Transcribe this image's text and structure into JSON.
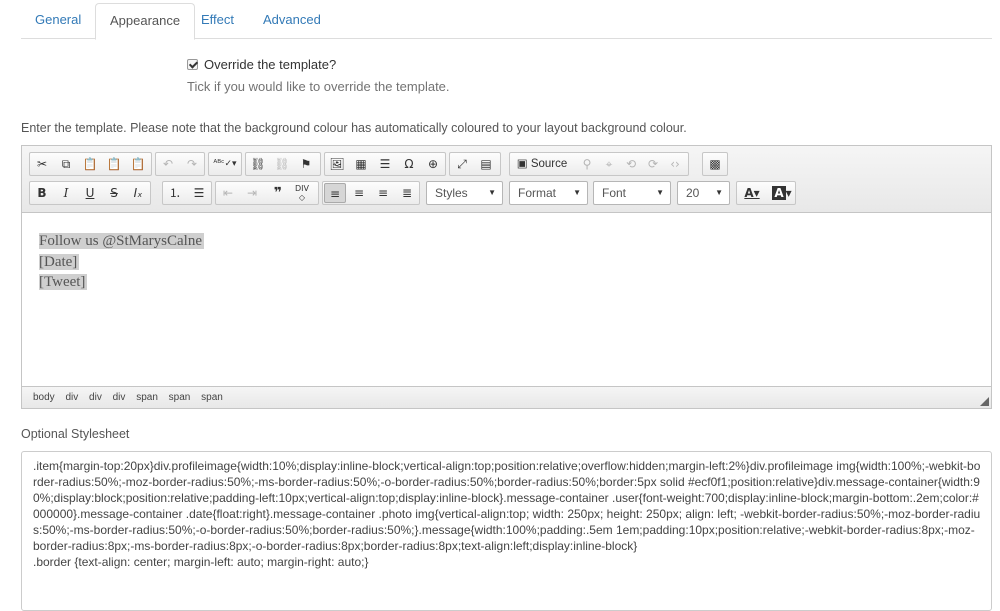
{
  "tabs": [
    {
      "label": "General",
      "active": false
    },
    {
      "label": "Appearance",
      "active": true
    },
    {
      "label": "Effect",
      "active": false
    },
    {
      "label": "Advanced",
      "active": false
    }
  ],
  "override": {
    "label": "Override the template?",
    "checked": true,
    "help": "Tick if you would like to override the template."
  },
  "intro": "Enter the template. Please note that the background colour has automatically coloured to your layout background colour.",
  "editor": {
    "source_label": "Source",
    "styles": "Styles",
    "format": "Format",
    "font": "Font",
    "size": "20",
    "content_lines": [
      "Follow us @StMarysCalne",
      "[Date]",
      "[Tweet]"
    ],
    "path": [
      "body",
      "div",
      "div",
      "div",
      "span",
      "span",
      "span"
    ]
  },
  "stylesheet": {
    "label": "Optional Stylesheet",
    "value": ".item{margin-top:20px}div.profileimage{width:10%;display:inline-block;vertical-align:top;position:relative;overflow:hidden;margin-left:2%}div.profileimage img{width:100%;-webkit-border-radius:50%;-moz-border-radius:50%;-ms-border-radius:50%;-o-border-radius:50%;border-radius:50%;border:5px solid #ecf0f1;position:relative}div.message-container{width:90%;display:block;position:relative;padding-left:10px;vertical-align:top;display:inline-block}.message-container .user{font-weight:700;display:inline-block;margin-bottom:.2em;color:#000000}.message-container .date{float:right}.message-container .photo img{vertical-align:top; width: 250px; height: 250px; align: left; -webkit-border-radius:50%;-moz-border-radius:50%;-ms-border-radius:50%;-o-border-radius:50%;border-radius:50%;}.message{width:100%;padding:.5em 1em;padding:10px;position:relative;-webkit-border-radius:8px;-moz-border-radius:8px;-ms-border-radius:8px;-o-border-radius:8px;border-radius:8px;text-align:left;display:inline-block}\n.border {text-align: center; margin-left: auto; margin-right: auto;}"
  }
}
